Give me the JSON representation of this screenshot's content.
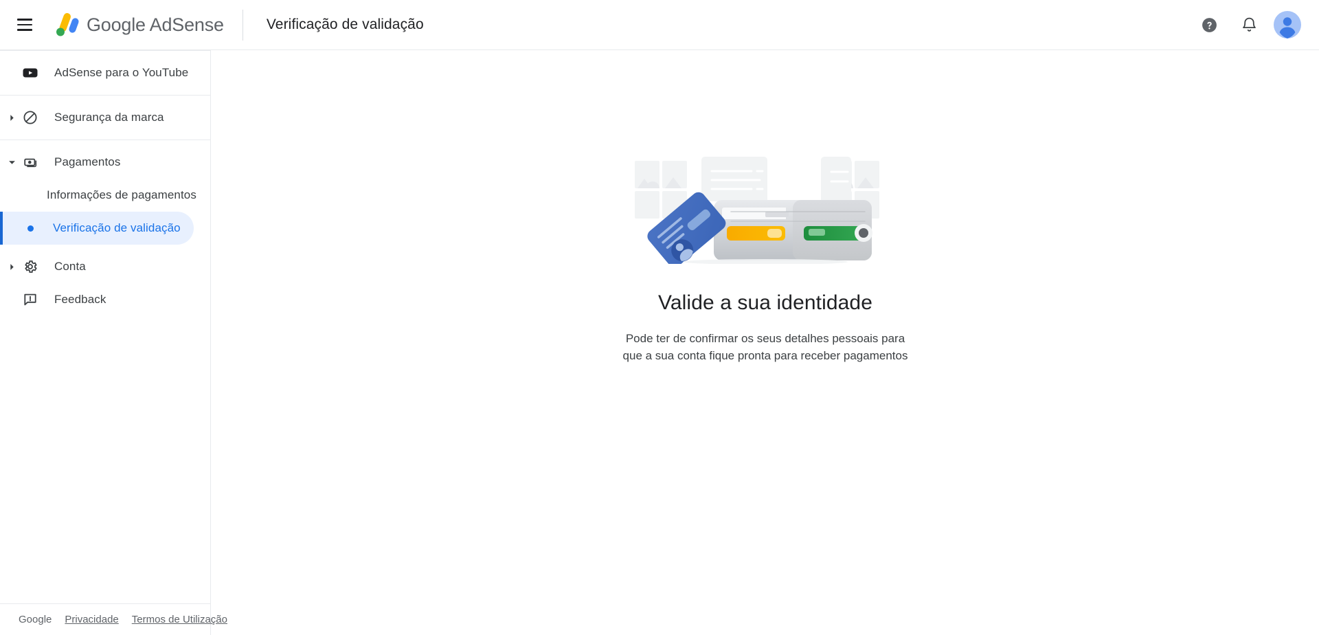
{
  "topbar": {
    "menu_label": "Menu principal",
    "brand": "Google AdSense",
    "page_title": "Verificação de validação",
    "help_label": "Ajuda",
    "notifications_label": "Notificações",
    "account_label": "Conta Google",
    "brand_colors": {
      "yellow": "#fbbc04",
      "green": "#34a853",
      "blue": "#4285f4",
      "text": "#5f6368"
    }
  },
  "sidebar": {
    "items": [
      {
        "id": "youtube",
        "label": "AdSense para o YouTube",
        "icon": "youtube-icon",
        "caret": "none",
        "active": false
      },
      {
        "id": "brand-safety",
        "label": "Segurança da marca",
        "icon": "block-icon",
        "caret": "right",
        "active": false
      },
      {
        "id": "payments",
        "label": "Pagamentos",
        "icon": "payments-icon",
        "caret": "down",
        "active": false
      },
      {
        "id": "account",
        "label": "Conta",
        "icon": "gear-icon",
        "caret": "right",
        "active": false
      },
      {
        "id": "feedback",
        "label": "Feedback",
        "icon": "feedback-icon",
        "caret": "none",
        "active": false
      }
    ],
    "payments_children": [
      {
        "id": "payments-info",
        "label": "Informações de pagamentos",
        "active": false
      },
      {
        "id": "validation-check",
        "label": "Verificação de validação",
        "active": true
      }
    ],
    "active_color": "#1a73e8",
    "active_bg": "#e8f0fe"
  },
  "footer": {
    "google": "Google",
    "privacy": "Privacidade",
    "terms": "Termos de Utilização"
  },
  "main": {
    "illustration_name": "identity-verification-illustration",
    "title": "Valide a sua identidade",
    "subtitle_line1": "Pode ter de confirmar os seus detalhes pessoais para",
    "subtitle_line2": "que a sua conta fique pronta para receber pagamentos"
  }
}
